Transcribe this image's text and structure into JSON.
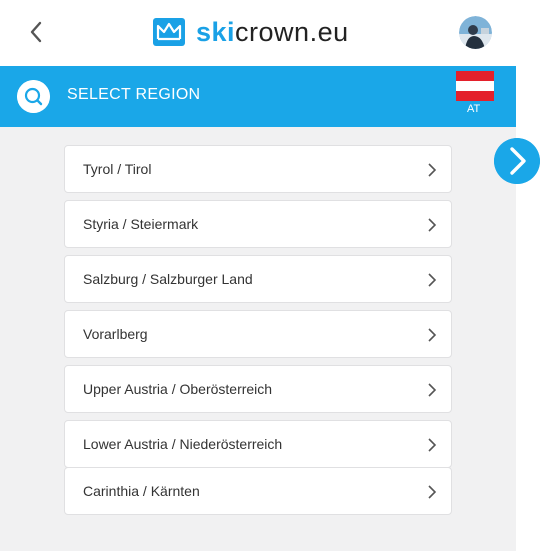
{
  "header": {
    "logo_ski": "ski",
    "logo_rest": "crown.eu"
  },
  "region_bar": {
    "title": "SELECT REGION",
    "country_code": "AT"
  },
  "regions": [
    {
      "label": "Tyrol / Tirol"
    },
    {
      "label": "Styria / Steiermark"
    },
    {
      "label": "Salzburg / Salzburger Land"
    },
    {
      "label": "Vorarlberg"
    },
    {
      "label": "Upper Austria / Oberösterreich"
    },
    {
      "label": "Lower Austria / Niederösterreich"
    },
    {
      "label": "Carinthia / Kärnten"
    }
  ],
  "icons": {
    "back": "chevron-left-icon",
    "search": "search-icon",
    "flag": "austria-flag-icon",
    "next": "chevron-right-icon",
    "item": "chevron-right-icon"
  },
  "colors": {
    "accent": "#1aa7e8",
    "logo_blue": "#1aa1e6",
    "list_bg": "#f1f1f2",
    "flag_red": "#e4202b"
  }
}
